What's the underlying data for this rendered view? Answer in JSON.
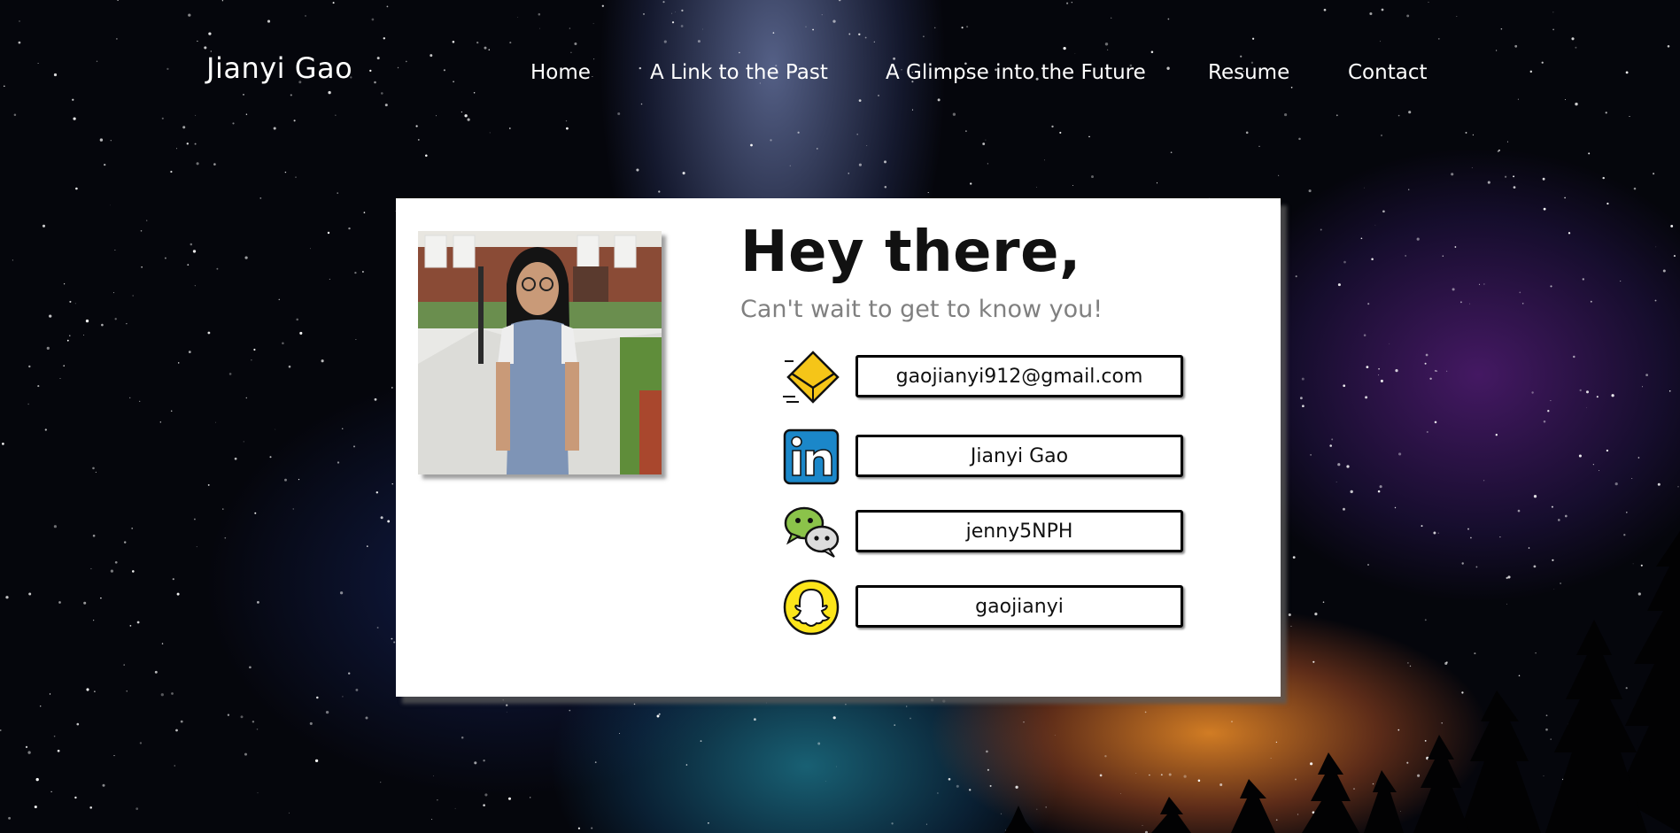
{
  "nav": {
    "brand": "Jianyi Gao",
    "items": [
      {
        "label": "Home"
      },
      {
        "label": "A Link to the Past"
      },
      {
        "label": "A Glimpse into the Future"
      },
      {
        "label": "Resume"
      },
      {
        "label": "Contact"
      }
    ]
  },
  "card": {
    "heading": "Hey there,",
    "subheading": "Can't wait to get to know you!",
    "contacts": [
      {
        "icon": "email-icon",
        "value": "gaojianyi912@gmail.com"
      },
      {
        "icon": "linkedin-icon",
        "value": "Jianyi Gao"
      },
      {
        "icon": "wechat-icon",
        "value": "jenny5NPH"
      },
      {
        "icon": "snapchat-icon",
        "value": "gaojianyi"
      }
    ]
  },
  "colors": {
    "card_background": "#ffffff",
    "subheading": "#808080",
    "nav_text": "#ffffff",
    "email_yellow": "#f5c518",
    "linkedin_blue": "#1b87c9",
    "wechat_green": "#8bc34a",
    "snapchat_yellow": "#fce51a"
  }
}
